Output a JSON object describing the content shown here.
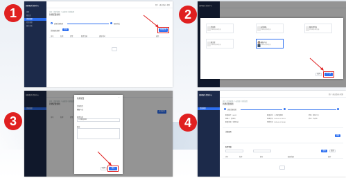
{
  "colors": {
    "accent": "#2d6ff0",
    "sidebar": "#1c2a4a",
    "highlight": "#e02020",
    "number": "#e02020"
  },
  "steps": [
    "1",
    "2",
    "3",
    "4"
  ],
  "sidebar": {
    "brand": "国网服务资源中心",
    "items": [
      "首页",
      "知识库",
      "资源管理",
      "任务管理",
      "统计分析",
      "设置"
    ]
  },
  "topbar": {
    "right": "用户  |  退出登录  |  帮助"
  },
  "breadcrumb": "首页 / 资源管理 / 人员管理 / 新增配置",
  "page_title": "新增配置规则",
  "step_labels": {
    "a": "选择资源类型",
    "b": "配置完成"
  },
  "panel1": {
    "filter_label": "资源配置规则",
    "filter_button": "查询",
    "action_button": "新增配置",
    "columns": [
      "序号",
      "名称",
      "类型",
      "配置范围",
      "更新时间",
      "操作"
    ]
  },
  "panel2": {
    "cards": [
      {
        "title": "资源池",
        "sub": "资源类别说明信息"
      },
      {
        "title": "运营团队",
        "sub": "资源类别说明信息"
      },
      {
        "title": "服务提供商",
        "sub": "资源类别说明信息"
      },
      {
        "title": "知识库",
        "sub": "资源类别说明信息"
      },
      {
        "title": "客服人员",
        "sub": "资源类别说明信息"
      }
    ],
    "cancel": "取消",
    "confirm": "下一步"
  },
  "panel3": {
    "modal_title": "新增配置",
    "labels": [
      "资源类型",
      "配置名称",
      "备注"
    ],
    "values": [
      "客服人员",
      "人员配置规则",
      ""
    ],
    "cancel": "取消",
    "confirm": "确定"
  },
  "panel4": {
    "info": [
      [
        "配置编号：00012",
        "配置名称：人员配置规则",
        "类型：客服人员"
      ],
      [
        "创建人：管理员",
        "创建时间：2023-05-12 10:21",
        "状态：已启用"
      ],
      [
        "配置范围：全部区域",
        "更新时间：2023-05-12 10:30",
        ""
      ]
    ],
    "section1": "关联配置",
    "section2": "配置明细",
    "add_button": "添加",
    "search_placeholder": "请输入",
    "search_button": "查询",
    "reset_button": "重置",
    "columns": [
      "序号",
      "名称",
      "编号",
      "配置范围",
      "操作"
    ]
  }
}
